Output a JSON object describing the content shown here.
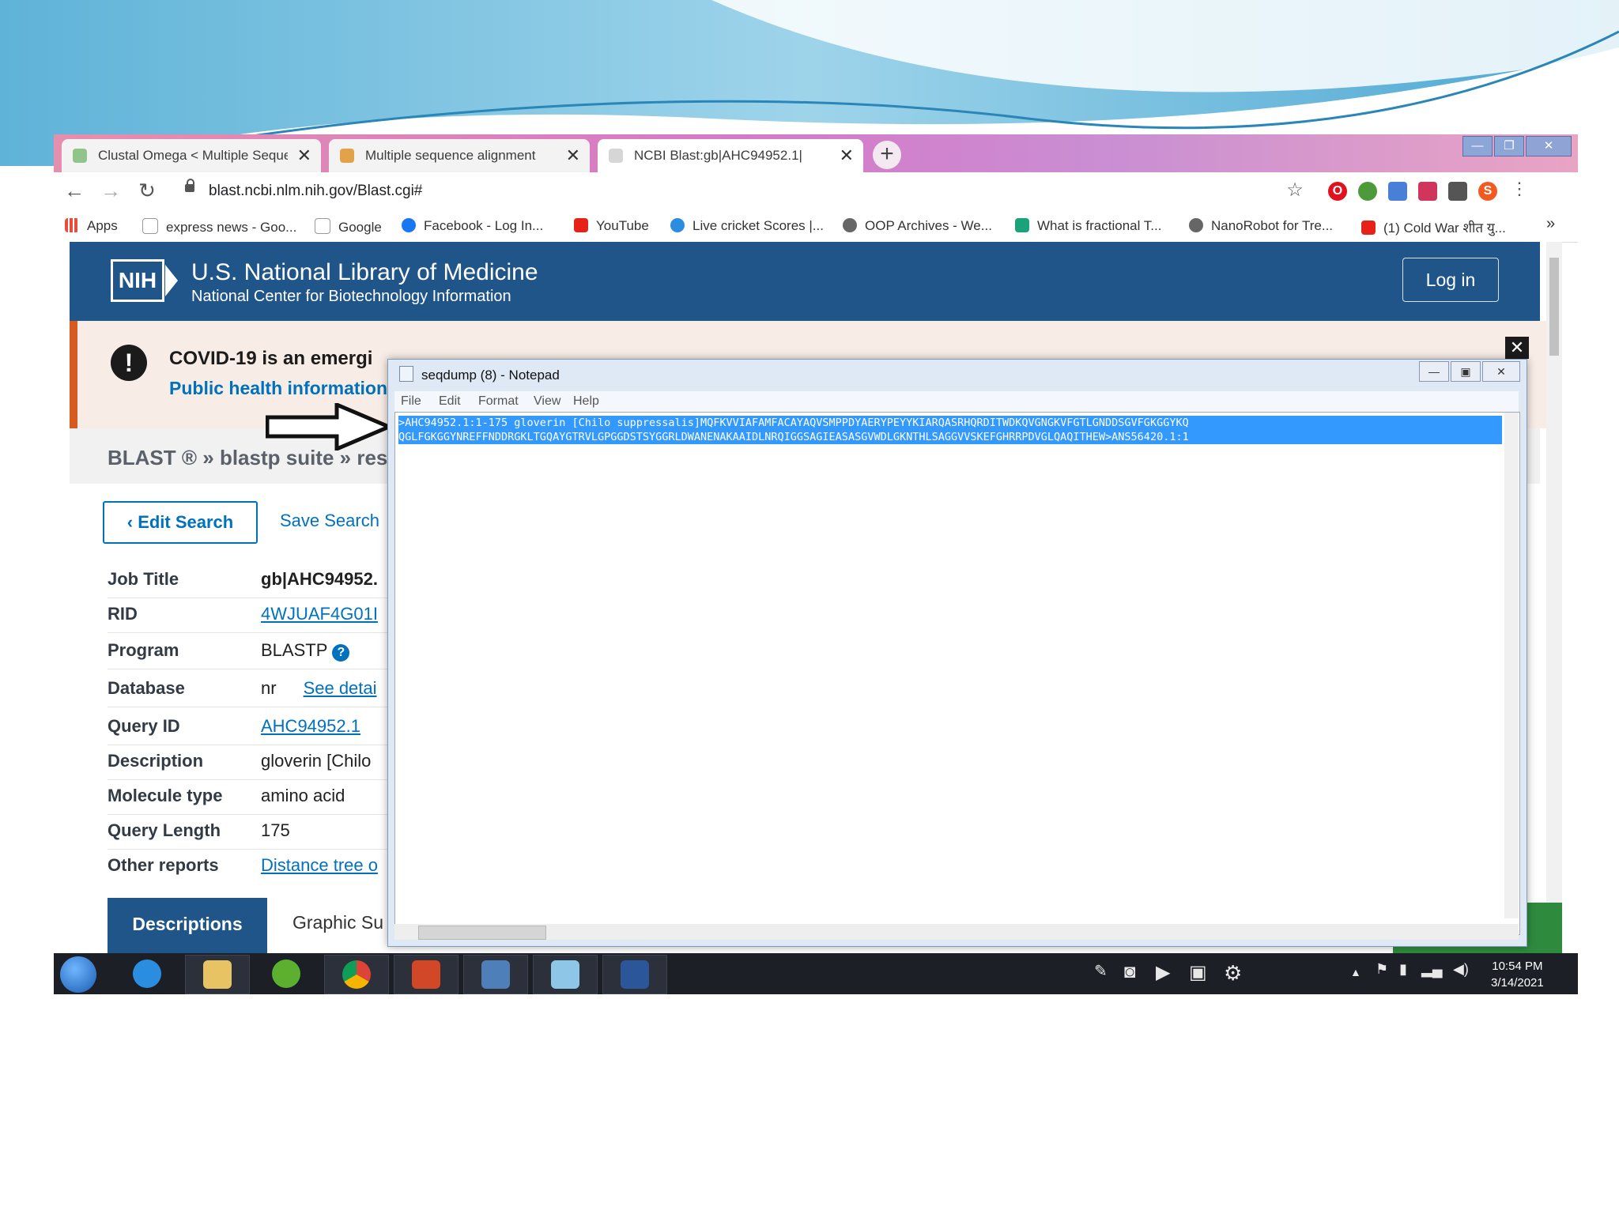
{
  "browser": {
    "tabs": [
      {
        "title": "Clustal Omega < Multiple Seque",
        "active": false
      },
      {
        "title": "Multiple sequence alignment",
        "active": false
      },
      {
        "title": "NCBI Blast:gb|AHC94952.1|",
        "active": true
      }
    ],
    "new_tab_label": "+",
    "url": "blast.ncbi.nlm.nih.gov/Blast.cgi#",
    "bookmarks": [
      "Apps",
      "express news - Goo...",
      "Google",
      "Facebook - Log In...",
      "YouTube",
      "Live cricket Scores |...",
      "OOP Archives - We...",
      "What is fractional T...",
      "NanoRobot for Tre...",
      "(1) Cold War शीत यु..."
    ],
    "profile_initial": "S"
  },
  "ncbi": {
    "header_title": "U.S. National Library of Medicine",
    "header_subtitle": "National Center for Biotechnology Information",
    "logo": "NIH",
    "login": "Log in",
    "covid_heading": "COVID-19 is an emergi",
    "covid_link": "Public health information",
    "breadcrumb": "BLAST ® » blastp suite » res",
    "edit_search": "‹ Edit Search",
    "save_search": "Save Search",
    "job_info": [
      {
        "label": "Job Title",
        "value": "gb|AHC94952.",
        "style": "bold"
      },
      {
        "label": "RID",
        "value": "4WJUAF4G01I",
        "style": "link"
      },
      {
        "label": "Program",
        "value": "BLASTP",
        "style": "help"
      },
      {
        "label": "Database",
        "value": "nr",
        "extra": "See detai",
        "style": "plain"
      },
      {
        "label": "Query ID",
        "value": "AHC94952.1",
        "style": "link"
      },
      {
        "label": "Description",
        "value": "gloverin [Chilo",
        "style": "plain"
      },
      {
        "label": "Molecule type",
        "value": "amino acid",
        "style": "plain"
      },
      {
        "label": "Query Length",
        "value": "175",
        "style": "plain"
      },
      {
        "label": "Other reports",
        "value": "Distance tree o",
        "style": "link"
      }
    ],
    "tabs": [
      "Descriptions",
      "Graphic Su"
    ]
  },
  "notepad": {
    "title": "seqdump (8) - Notepad",
    "menu": [
      "File",
      "Edit",
      "Format",
      "View",
      "Help"
    ],
    "lines": [
      ">AHC94952.1:1-175 gloverin [Chilo suppressalis]MQFKVVIAFAMFACAYAQVSMPPDYAERYPEYYKIARQASRHQRDITWDKQVGNGKVFGTLGNDDSGVFGKGGYKQ",
      "QGLFGKGGYNREFFNDDRGKLTGQAYGTRVLGPGGDSTSYGGRLDWANENAKAAIDLNRQIGGSAGIEASASGVWDLGKNTHLSAGGVVSKEFGHRRPDVGLQAQITHEW>ANS56420.1:1"
    ]
  },
  "taskbar": {
    "time": "10:54 PM",
    "date": "3/14/2021"
  },
  "colors": {
    "ncbi_blue": "#20558a",
    "link_blue": "#0071bc",
    "covid_orange": "#d75b21",
    "selection": "#3399ff"
  }
}
